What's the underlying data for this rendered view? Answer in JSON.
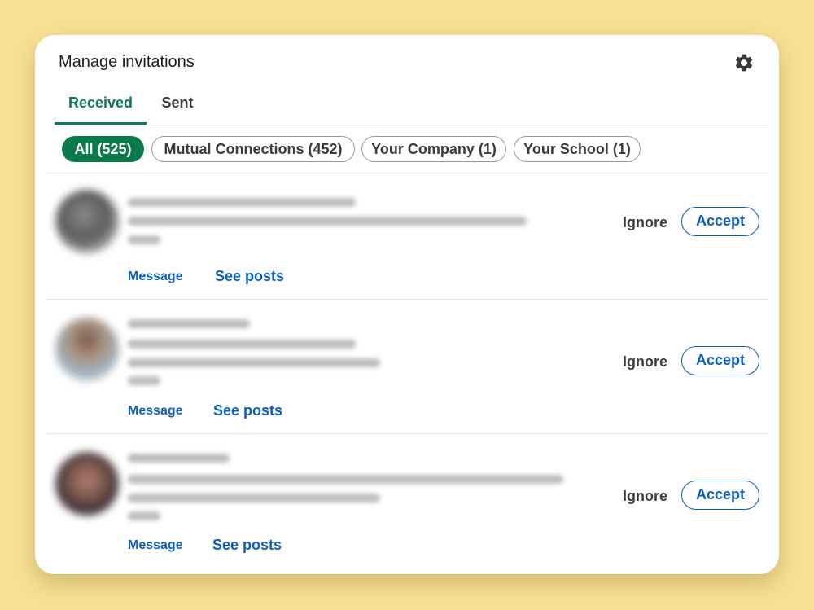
{
  "header": {
    "title": "Manage invitations",
    "settings_icon": "gear-icon"
  },
  "tabs": [
    {
      "label": "Received",
      "active": true
    },
    {
      "label": "Sent",
      "active": false
    }
  ],
  "filters": [
    {
      "label": "All (525)",
      "active": true
    },
    {
      "label": "Mutual Connections (452)",
      "active": false
    },
    {
      "label": "Your Company (1)",
      "active": false
    },
    {
      "label": "Your School (1)",
      "active": false
    }
  ],
  "invitations": [
    {
      "message_label": "Message",
      "posts_label": "See posts",
      "ignore_label": "Ignore",
      "accept_label": "Accept"
    },
    {
      "message_label": "Message",
      "posts_label": "See posts",
      "ignore_label": "Ignore",
      "accept_label": "Accept"
    },
    {
      "message_label": "Message",
      "posts_label": "See posts",
      "ignore_label": "Ignore",
      "accept_label": "Accept"
    }
  ],
  "colors": {
    "background": "#f7df93",
    "brand_green": "#0d7a4e",
    "link_blue": "#0b5fbd"
  }
}
